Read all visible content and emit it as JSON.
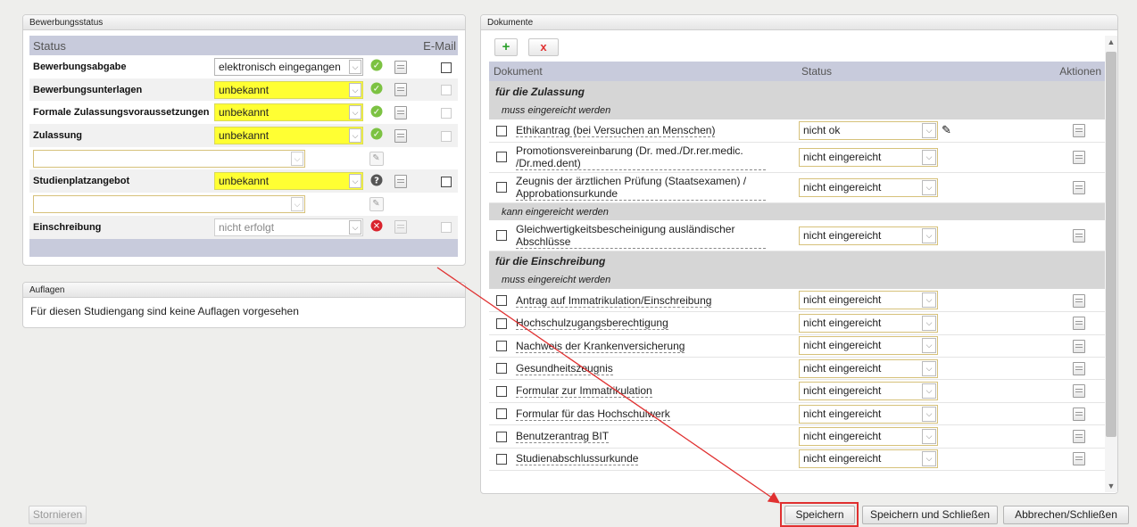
{
  "bewerbungsstatus": {
    "title": "Bewerbungsstatus",
    "col_status": "Status",
    "col_email": "E-Mail",
    "rows": [
      {
        "label": "Bewerbungsabgabe",
        "value": "elektronisch eingegangen",
        "status_icon": "check-circle-icon"
      },
      {
        "label": "Bewerbungsunterlagen",
        "value": "unbekannt",
        "status_icon": "check-circle-icon"
      },
      {
        "label": "Formale Zulassungsvoraussetzungen",
        "value": "unbekannt",
        "status_icon": "check-circle-icon"
      },
      {
        "label": "Zulassung",
        "value": "unbekannt",
        "status_icon": "check-circle-icon"
      },
      {
        "label": "",
        "value": ""
      },
      {
        "label": "Studienplatzangebot",
        "value": "unbekannt",
        "status_icon": "question-circle-icon"
      },
      {
        "label": "",
        "value": ""
      },
      {
        "label": "Einschreibung",
        "value": "nicht erfolgt",
        "status_icon": "x-circle-icon"
      }
    ]
  },
  "auflagen": {
    "title": "Auflagen",
    "text": "Für diesen Studiengang sind keine Auflagen vorgesehen"
  },
  "dokumente": {
    "title": "Dokumente",
    "add_icon": "plus-icon",
    "remove_icon": "x-icon",
    "col_document": "Dokument",
    "col_status": "Status",
    "col_actions": "Aktionen",
    "groups": [
      {
        "title": "für die Zulassung",
        "sections": [
          {
            "title": "muss eingereicht werden",
            "docs": [
              {
                "name": "Ethikantrag (bei Versuchen an Menschen)",
                "status": "nicht ok"
              },
              {
                "name": "Promotionsvereinbarung (Dr. med./Dr.rer.medic. /Dr.med.dent)",
                "status": "nicht eingereicht"
              },
              {
                "name": "Zeugnis der ärztlichen Prüfung (Staatsexamen) / Approbationsurkunde",
                "status": "nicht eingereicht"
              }
            ]
          },
          {
            "title": "kann eingereicht werden",
            "docs": [
              {
                "name": "Gleichwertigkeitsbescheinigung ausländischer Abschlüsse",
                "status": "nicht eingereicht"
              }
            ]
          }
        ]
      },
      {
        "title": "für die Einschreibung",
        "sections": [
          {
            "title": "muss eingereicht werden",
            "docs": [
              {
                "name": "Antrag auf Immatrikulation/Einschreibung",
                "status": "nicht eingereicht"
              },
              {
                "name": "Hochschulzugangsberechtigung",
                "status": "nicht eingereicht"
              },
              {
                "name": "Nachweis der Krankenversicherung",
                "status": "nicht eingereicht"
              },
              {
                "name": "Gesundheitszeugnis",
                "status": "nicht eingereicht"
              },
              {
                "name": "Formular zur Immatrikulation",
                "status": "nicht eingereicht"
              },
              {
                "name": "Formular für das Hochschulwerk",
                "status": "nicht eingereicht"
              },
              {
                "name": "Benutzerantrag BIT",
                "status": "nicht eingereicht"
              },
              {
                "name": "Studienabschlussurkunde",
                "status": "nicht eingereicht"
              }
            ]
          }
        ]
      }
    ]
  },
  "footer": {
    "cancel": "Stornieren",
    "save": "Speichern",
    "save_close": "Speichern und Schließen",
    "abort_close": "Abbrechen/Schließen"
  }
}
